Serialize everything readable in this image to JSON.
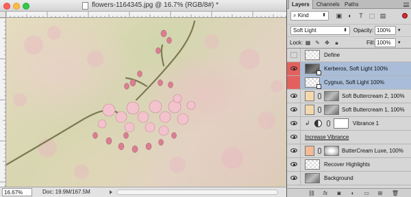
{
  "window": {
    "title": "flowers-1164345.jpg @ 16.7% (RGB/8#) *",
    "zoom": "16.67%",
    "doc_size": "Doc: 19.9M/167.5M"
  },
  "panel": {
    "tabs": [
      "Layers",
      "Channels",
      "Paths"
    ],
    "kind_filter": "Kind",
    "blend_mode": "Soft Light",
    "opacity_label": "Opacity:",
    "opacity_value": "100%",
    "lock_label": "Lock:",
    "fill_label": "Fill:",
    "fill_value": "100%",
    "layers": [
      {
        "name": "Define",
        "visible": false,
        "selected": false
      },
      {
        "name": "Kerberos, Soft Light 100%",
        "visible": true,
        "selected": true
      },
      {
        "name": "Cygnus, Soft Light 100%",
        "visible": false,
        "selected": true
      },
      {
        "name": "Soft Buttercream 2, 100%",
        "visible": true,
        "selected": false
      },
      {
        "name": "Soft Buttercream 1, 100%",
        "visible": true,
        "selected": false
      },
      {
        "name": "Vibrance 1",
        "visible": true,
        "selected": false
      },
      {
        "name": "Increase Vibrance",
        "visible": true,
        "selected": false
      },
      {
        "name": "ButterCream Luxe, 100%",
        "visible": true,
        "selected": false
      },
      {
        "name": "Recover Highlights",
        "visible": true,
        "selected": false
      },
      {
        "name": "Background",
        "visible": true,
        "selected": false
      }
    ],
    "footer_icons": [
      "link-icon",
      "fx-icon",
      "mask-icon",
      "adjustment-icon",
      "folder-icon",
      "new-layer-icon",
      "trash-icon"
    ]
  },
  "colors": {
    "visibility_highlight": "#e2615e",
    "selected_layer": "#a9bdd9"
  }
}
